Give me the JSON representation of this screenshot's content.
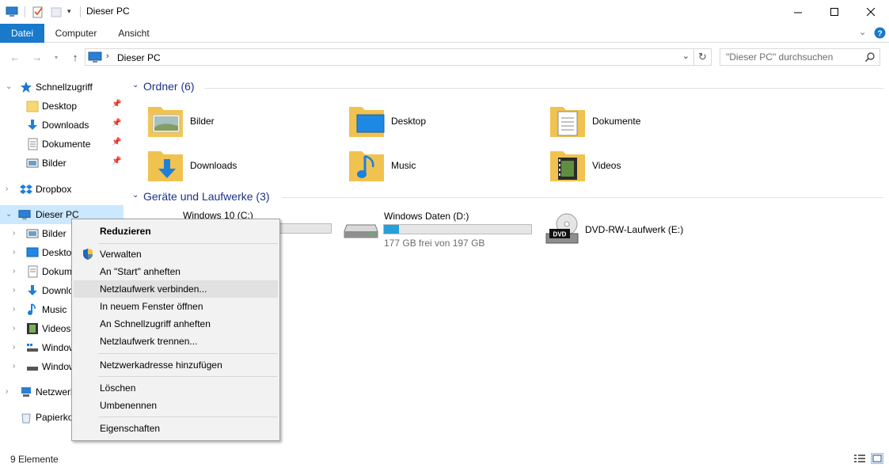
{
  "window": {
    "title": "Dieser PC",
    "minimize_icon": "minimize-icon",
    "maximize_icon": "maximize-icon",
    "close_icon": "close-icon"
  },
  "ribbon": {
    "tabs": [
      {
        "label": "Datei",
        "active": true
      },
      {
        "label": "Computer"
      },
      {
        "label": "Ansicht"
      }
    ]
  },
  "address": {
    "path": "Dieser PC",
    "search_placeholder": "\"Dieser PC\" durchsuchen"
  },
  "navpane": {
    "quick_access": {
      "label": "Schnellzugriff",
      "items": [
        {
          "label": "Desktop",
          "icon": "folder-icon"
        },
        {
          "label": "Downloads",
          "icon": "download-icon"
        },
        {
          "label": "Dokumente",
          "icon": "document-icon"
        },
        {
          "label": "Bilder",
          "icon": "pictures-icon"
        }
      ]
    },
    "dropbox": {
      "label": "Dropbox"
    },
    "this_pc": {
      "label": "Dieser PC",
      "items": [
        {
          "label": "Bilder"
        },
        {
          "label": "Deskto"
        },
        {
          "label": "Dokum"
        },
        {
          "label": "Downlo"
        },
        {
          "label": "Music"
        },
        {
          "label": "Videos"
        },
        {
          "label": "Window"
        },
        {
          "label": "Window"
        }
      ]
    },
    "network": {
      "label": "Netzwerk"
    },
    "recycle": {
      "label": "Papierko"
    }
  },
  "main": {
    "folders_header": "Ordner (6)",
    "folders": [
      {
        "label": "Bilder"
      },
      {
        "label": "Desktop"
      },
      {
        "label": "Dokumente"
      },
      {
        "label": "Downloads"
      },
      {
        "label": "Music"
      },
      {
        "label": "Videos"
      }
    ],
    "drives_header": "Geräte und Laufwerke (3)",
    "drives": [
      {
        "label": "Windows 10 (C:)",
        "used_fraction": 0.0
      },
      {
        "label": "Windows Daten (D:)",
        "free": "177 GB frei von 197 GB",
        "used_fraction": 0.1
      },
      {
        "label": "DVD-RW-Laufwerk (E:)",
        "badge": "DVD"
      }
    ]
  },
  "context_menu": {
    "items": [
      {
        "label": "Reduzieren",
        "bold": true
      },
      {
        "label": "Verwalten",
        "icon": "shield-icon"
      },
      {
        "label": "An \"Start\" anheften"
      },
      {
        "label": "Netzlaufwerk verbinden...",
        "highlighted": true
      },
      {
        "label": "In neuem Fenster öffnen"
      },
      {
        "label": "An Schnellzugriff anheften"
      },
      {
        "label": "Netzlaufwerk trennen..."
      },
      {
        "label": "Netzwerkadresse hinzufügen"
      },
      {
        "label": "Löschen"
      },
      {
        "label": "Umbenennen"
      },
      {
        "label": "Eigenschaften"
      }
    ]
  },
  "status": {
    "count": "9 Elemente"
  },
  "colors": {
    "accent": "#1979ca",
    "selection": "#cce8ff",
    "header_blue": "#1e3287",
    "drive_bar": "#26a0da"
  }
}
